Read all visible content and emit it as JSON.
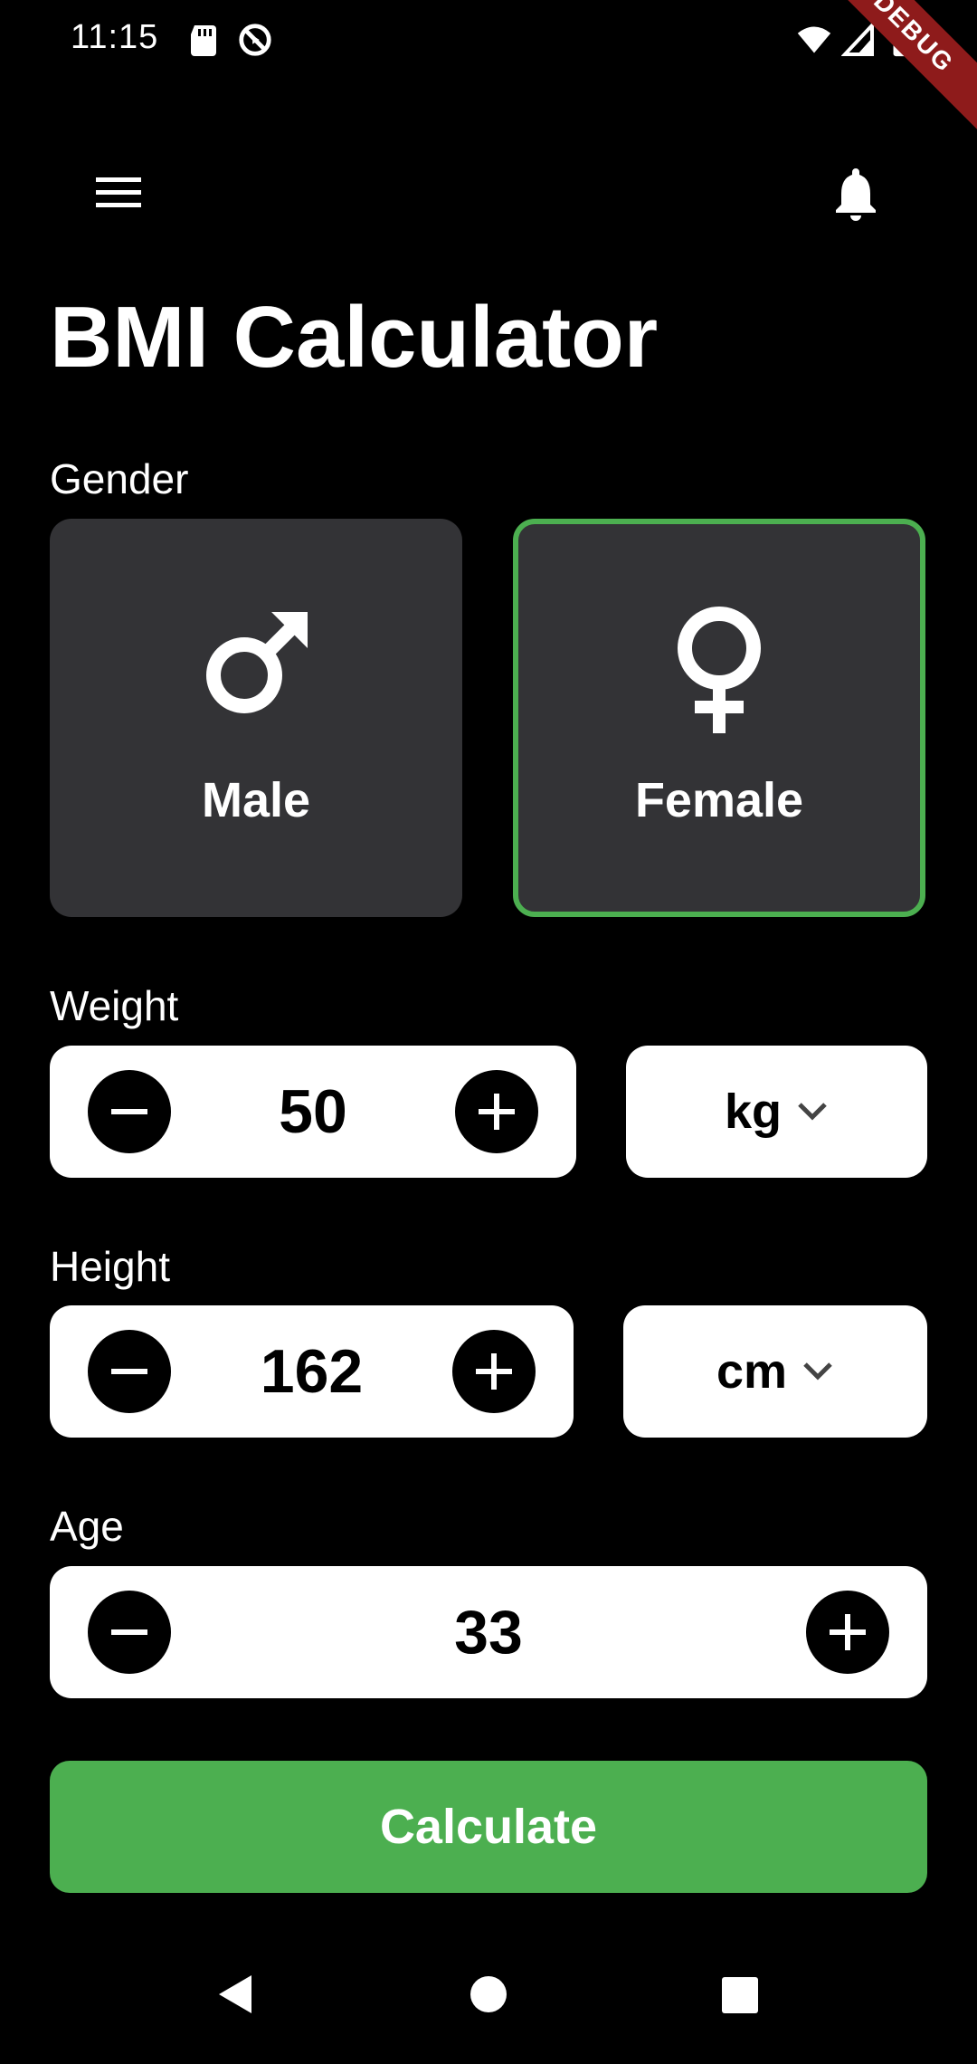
{
  "status_bar": {
    "time": "11:15",
    "debug_banner": "DEBUG",
    "icons": [
      "sd-card-icon",
      "sync-icon",
      "wifi-icon",
      "signal-icon",
      "battery-icon"
    ]
  },
  "app_bar": {
    "menu_icon": "menu-icon",
    "notification_icon": "bell-icon"
  },
  "title": "BMI Calculator",
  "gender": {
    "label": "Gender",
    "options": [
      {
        "label": "Male",
        "icon": "male-icon",
        "selected": false
      },
      {
        "label": "Female",
        "icon": "female-icon",
        "selected": true
      }
    ]
  },
  "weight": {
    "label": "Weight",
    "value": "50",
    "unit": "kg"
  },
  "height": {
    "label": "Height",
    "value": "162",
    "unit": "cm"
  },
  "age": {
    "label": "Age",
    "value": "33"
  },
  "calculate_label": "Calculate",
  "colors": {
    "background": "#000000",
    "card": "#333336",
    "accent": "#4caf50",
    "debug_ribbon": "#8e1b1b"
  },
  "nav_bar": {
    "icons": [
      "back-icon",
      "home-icon",
      "recents-icon"
    ]
  }
}
